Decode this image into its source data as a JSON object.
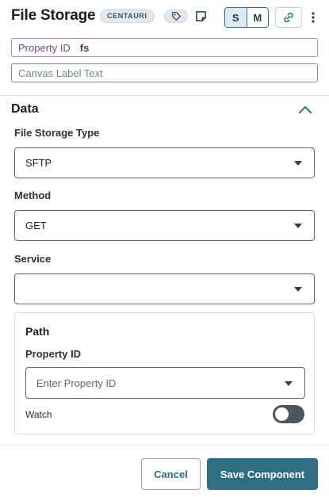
{
  "header": {
    "title": "File Storage",
    "badge": "CENTAURI",
    "size_s": "S",
    "size_m": "M"
  },
  "property_id": {
    "label": "Property ID",
    "value": "fs"
  },
  "canvas_label": {
    "placeholder": "Canvas Label Text"
  },
  "data_section": {
    "title": "Data",
    "file_storage_type": {
      "label": "File Storage Type",
      "value": "SFTP"
    },
    "method": {
      "label": "Method",
      "value": "GET"
    },
    "service": {
      "label": "Service",
      "value": ""
    }
  },
  "path": {
    "title": "Path",
    "property_id_label": "Property ID",
    "property_id_placeholder": "Enter Property ID",
    "watch_label": "Watch",
    "watch_on": false
  },
  "footer": {
    "cancel_label": "Cancel",
    "save_label": "Save Component"
  },
  "colors": {
    "accent": "#2f6f84",
    "property_purple": "#7c3fa6"
  }
}
